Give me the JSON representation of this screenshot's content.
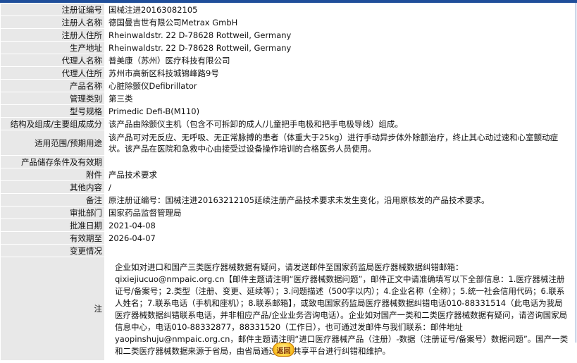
{
  "rows": [
    {
      "label": "注册证编号",
      "value": "国械注进20163082105"
    },
    {
      "label": "注册人名称",
      "value": "德国曼吉世有限公司Metrax GmbH"
    },
    {
      "label": "注册人住所",
      "value": "Rheinwaldstr. 22 D-78628 Rottweil, Germany"
    },
    {
      "label": "生产地址",
      "value": "Rheinwaldstr. 22 D-78628 Rottweil, Germany"
    },
    {
      "label": "代理人名称",
      "value": "普美康（苏州）医疗科技有限公司"
    },
    {
      "label": "代理人住所",
      "value": "苏州市高新区科技城锦峰路9号"
    },
    {
      "label": "产品名称",
      "value": "心脏除颤仪Defibrillator"
    },
    {
      "label": "管理类别",
      "value": "第三类"
    },
    {
      "label": "型号规格",
      "value": "Primedic Defi-B(M110)"
    },
    {
      "label": "结构及组成/主要组成成分",
      "value": "该产品由除颤仪主机（包含不可拆卸的成人/儿童把手电极和把手电极导线）组成。"
    },
    {
      "label": "适用范围/预期用途",
      "value": "该产品可对无反应、无呼吸、无正常脉搏的患者（体重大于25kg）进行手动异步体外除颤治疗，终止其心动过速和心室颤动症状。该产品在医院和急救中心由接受过设备操作培训的合格医务人员使用。"
    },
    {
      "label": "产品储存条件及有效期",
      "value": ""
    },
    {
      "label": "附件",
      "value": "产品技术要求"
    },
    {
      "label": "其他内容",
      "value": "/"
    },
    {
      "label": "备注",
      "value": "原注册证编号：国械注进20163212105延续注册产品技术要求未发生变化，沿用原核发的产品技术要求。"
    },
    {
      "label": "审批部门",
      "value": "国家药品监督管理局"
    },
    {
      "label": "批准日期",
      "value": "2021-04-08"
    },
    {
      "label": "有效期至",
      "value": "2026-04-07"
    },
    {
      "label": "变更情况",
      "value": ""
    }
  ],
  "note": {
    "label": "注",
    "text": "企业如对进口和国产三类医疗器械数据有疑问，请发送邮件至国家药监局医疗器械数据纠错邮箱：qixiejiucuo@nmpaic.org.cn【邮件主题请注明“医疗器械数据问题”，邮件正文中请准确填写以下全部信息：1.医疗器械注册证号/备案号；2.类型（注册、变更、延续等）；3.问题描述（500字以内）；4.企业名称（全称）；5.统一社会信用代码；6.联系人姓名；7.联系电话（手机和座机）；8.联系邮箱】，或致电国家药监局医疗器械数据纠错电话010-88331514（此电话为我局医疗器械数据纠错联系电话，并非相应产品/企业业务咨询电话）。企业如对国产一类和二类医疗器械数据有疑问，请咨询国家局信息中心，电话010-88332877，88331520（工作日），也可通过发邮件与我们联系：邮件地址yaopinshuju@nmpaic.org.cn，邮件主题请注明“进口医疗器械产品（注册）-数据（注册证号/备案号）数据问题”。国产一类和二类医疗器械数据来源于省局，由省局通过数据共享平台进行纠错和维护。"
  },
  "back_button": {
    "label": "返回"
  }
}
